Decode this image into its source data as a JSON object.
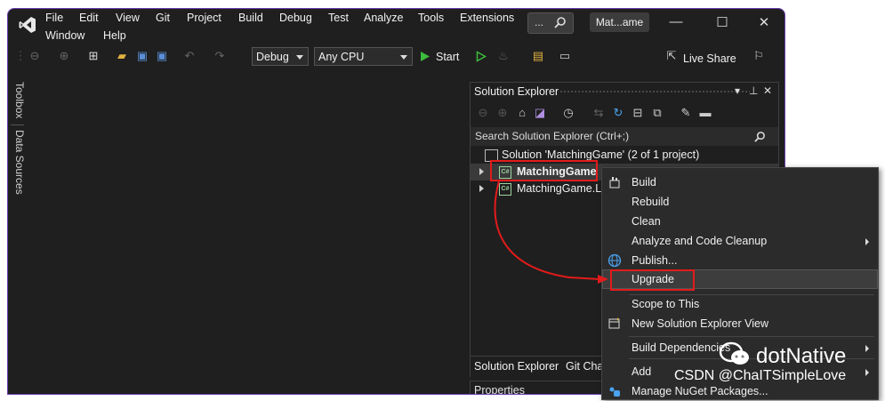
{
  "menu": [
    "File",
    "Edit",
    "View",
    "Git",
    "Project",
    "Build",
    "Debug",
    "Test",
    "Analyze",
    "Tools",
    "Extensions",
    "Window",
    "Help"
  ],
  "search_label": "...",
  "title_tab": "Mat...ame",
  "toolbar": {
    "config": "Debug",
    "platform": "Any CPU",
    "start": "Start",
    "live_share": "Live Share"
  },
  "side_tabs": [
    "Toolbox",
    "Data Sources"
  ],
  "solution_explorer": {
    "title": "Solution Explorer",
    "search_placeholder": "Search Solution Explorer (Ctrl+;)",
    "solution_row": "Solution 'MatchingGame' (2 of 1 project)",
    "project_row": "MatchingGame",
    "project_row2": "MatchingGame.Lo",
    "tabs": [
      "Solution Explorer",
      "Git Cha"
    ]
  },
  "properties_title": "Properties",
  "context_menu": {
    "items": [
      "Build",
      "Rebuild",
      "Clean",
      "Analyze and Code Cleanup",
      "Publish...",
      "Upgrade",
      "Scope to This",
      "New Solution Explorer View",
      "Build Dependencies",
      "Add",
      "Manage NuGet Packages..."
    ]
  },
  "watermark": {
    "brand": "dotNative",
    "credit": "CSDN @ChaITSimpleLove"
  },
  "colors": {
    "accent_purple": "#6b3fb3",
    "highlight_red": "#e21b1b",
    "start_green": "#3dbb3d"
  }
}
